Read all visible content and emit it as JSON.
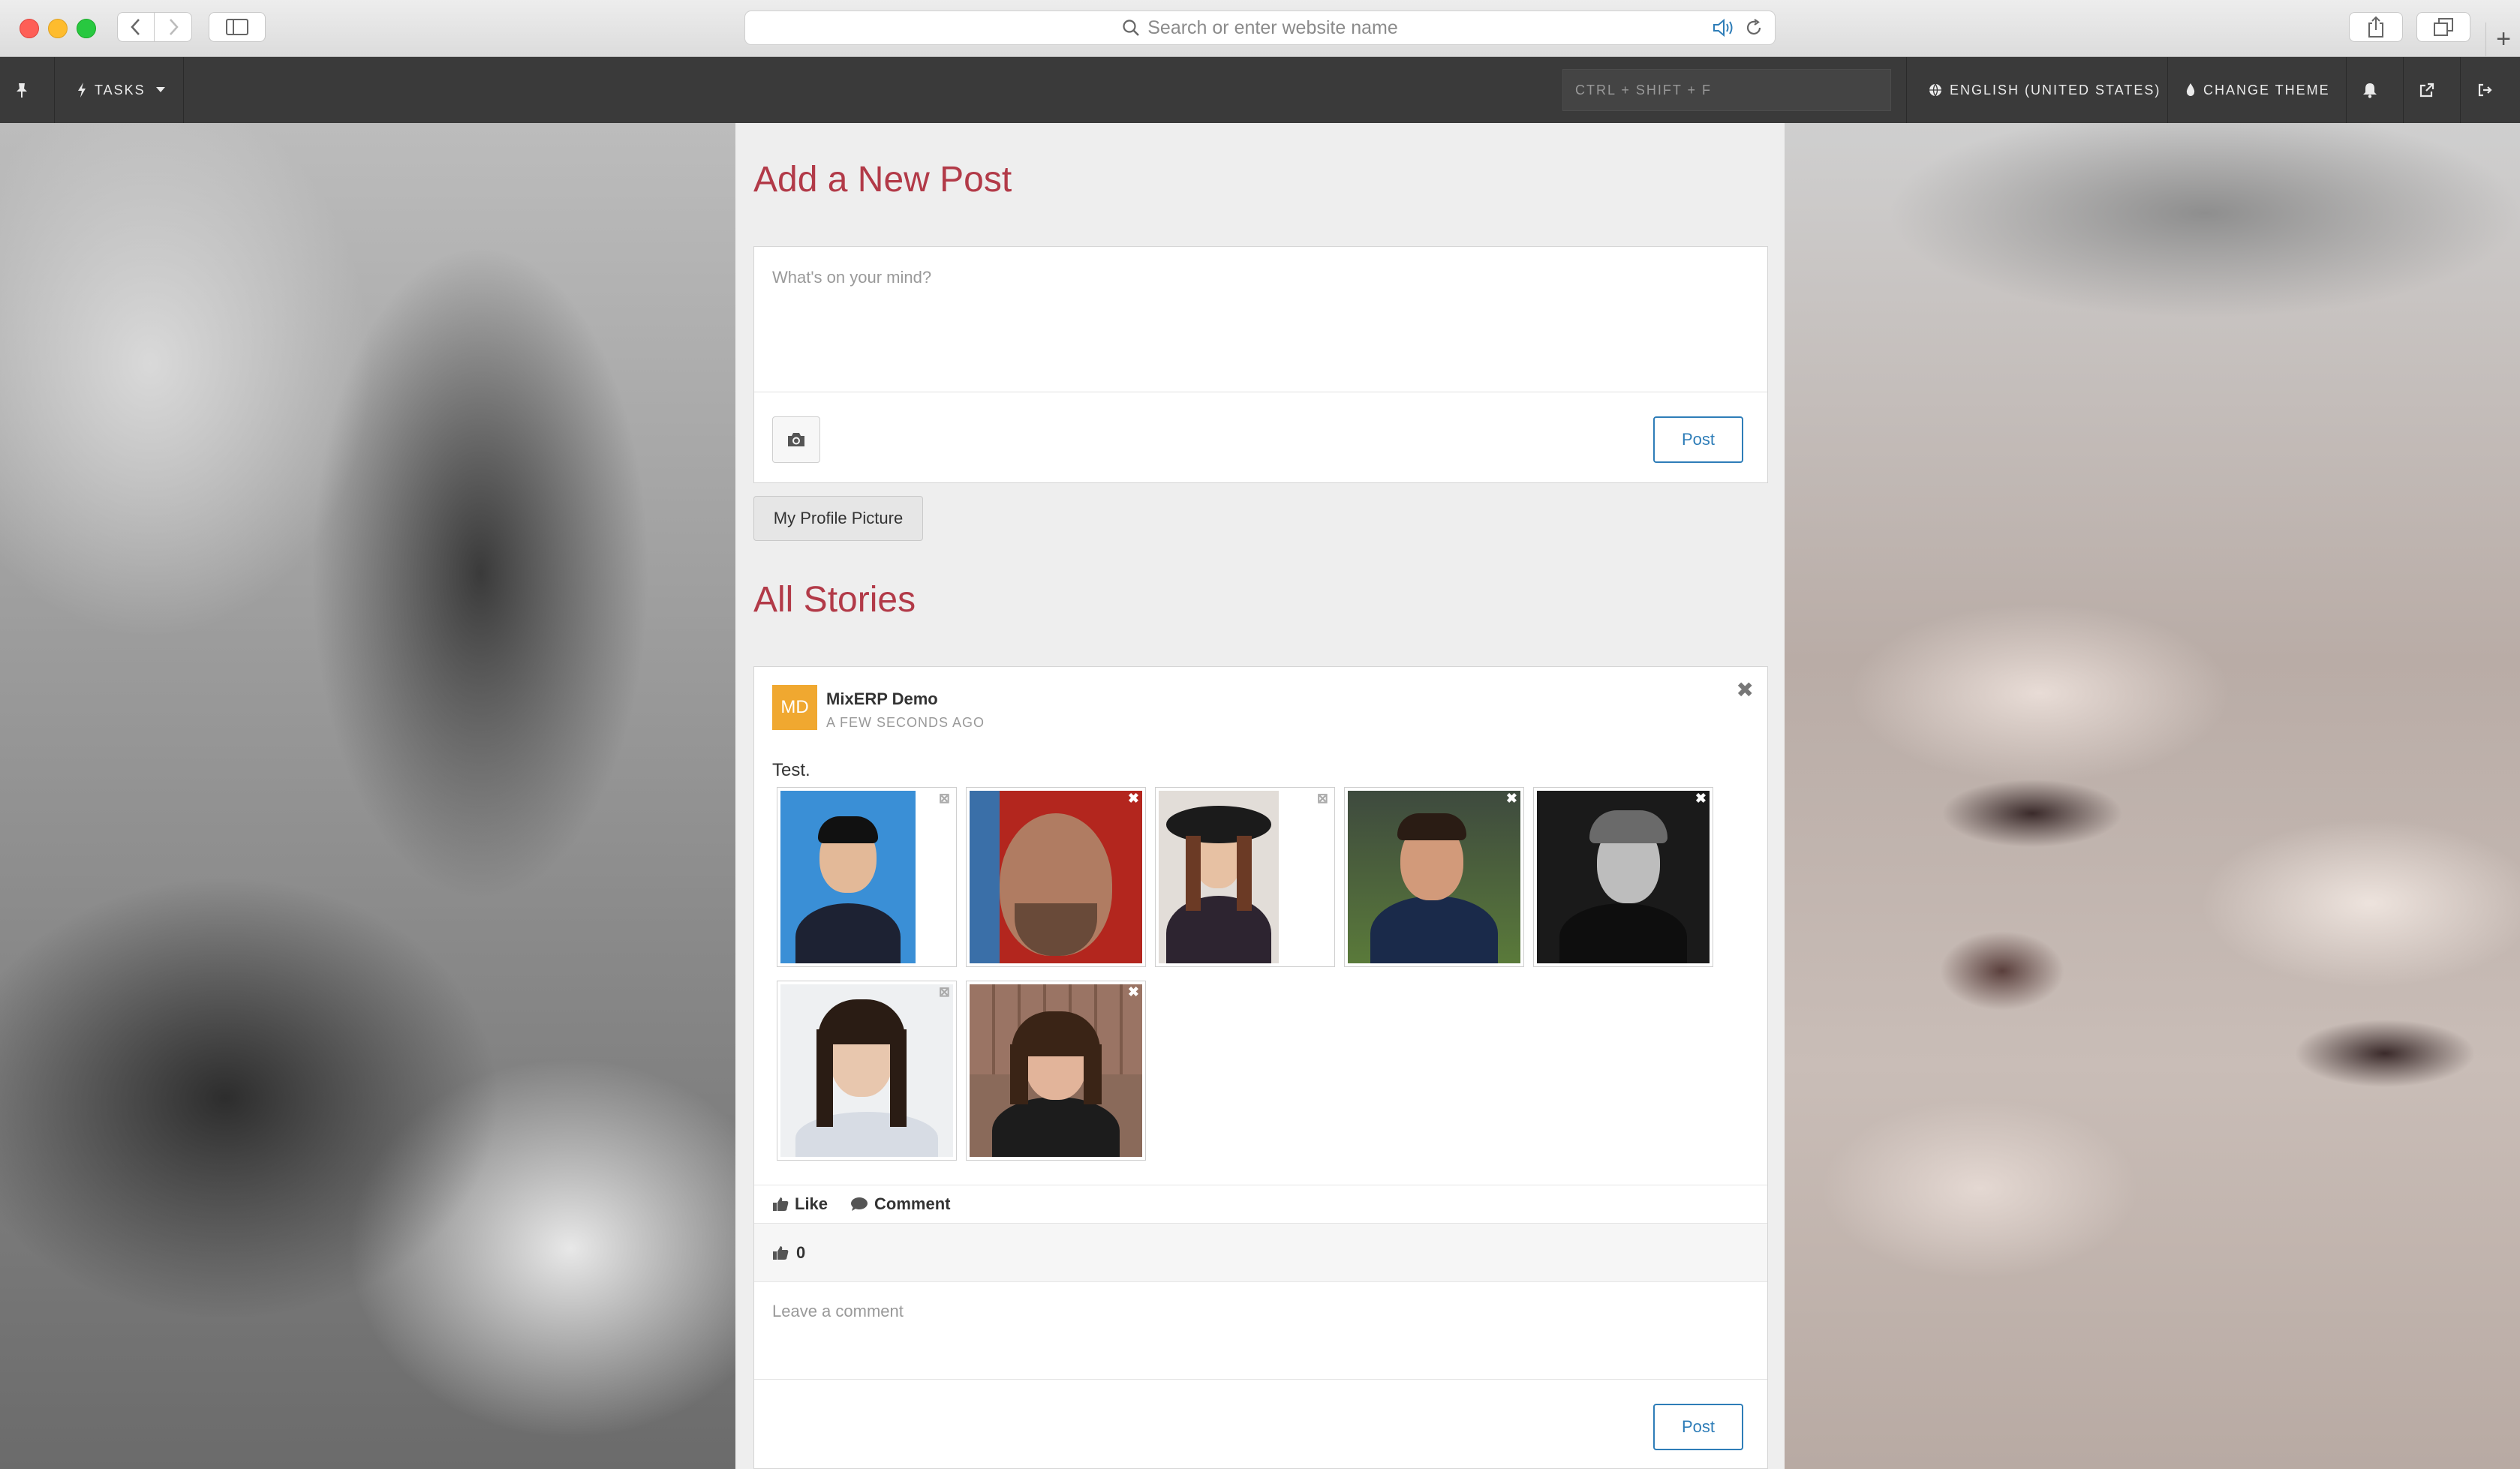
{
  "browser": {
    "url_placeholder": "Search or enter website name"
  },
  "appbar": {
    "tasks_label": "TASKS",
    "shortcut_placeholder": "CTRL + SHIFT + F",
    "language_label": "ENGLISH (UNITED STATES)",
    "theme_label": "CHANGE THEME"
  },
  "composer": {
    "title": "Add a New Post",
    "placeholder": "What's on your mind?",
    "post_label": "Post",
    "profile_picture_label": "My Profile Picture"
  },
  "stories": {
    "title": "All Stories",
    "items": [
      {
        "avatar_initials": "MD",
        "author": "MixERP Demo",
        "time_ago": "A FEW SECONDS AGO",
        "text": "Test.",
        "like_label": "Like",
        "comment_label": "Comment",
        "like_count": "0",
        "comment_placeholder": "Leave a comment",
        "post_label": "Post"
      }
    ]
  },
  "colors": {
    "accent_title": "#b23a48",
    "post_button": "#2e7db8",
    "avatar_bg": "#f0a830",
    "appbar_bg": "#3a3a3a"
  }
}
